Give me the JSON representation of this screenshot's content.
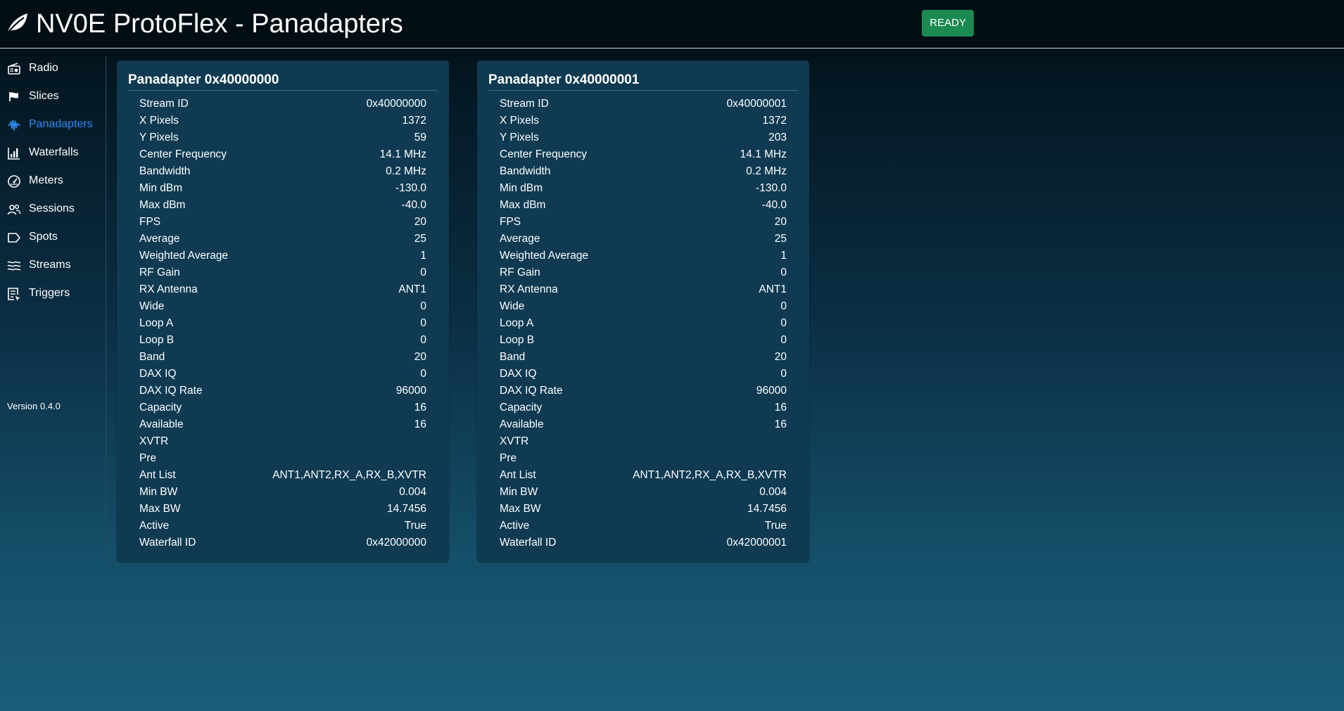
{
  "header": {
    "title": "NV0E  ProtoFlex - Panadapters",
    "logo_icon": "leaf-icon",
    "status": "READY",
    "status_color": "#1a8a51"
  },
  "sidebar": {
    "active_color": "#2d8cf0",
    "items": [
      {
        "label": "Radio",
        "icon": "radio-icon"
      },
      {
        "label": "Slices",
        "icon": "flag-icon"
      },
      {
        "label": "Panadapters",
        "icon": "waveform-icon",
        "active": true
      },
      {
        "label": "Waterfalls",
        "icon": "bar-chart-icon"
      },
      {
        "label": "Meters",
        "icon": "gauge-icon"
      },
      {
        "label": "Sessions",
        "icon": "people-icon"
      },
      {
        "label": "Spots",
        "icon": "tag-icon"
      },
      {
        "label": "Streams",
        "icon": "waves-icon"
      },
      {
        "label": "Triggers",
        "icon": "checklist-icon"
      }
    ],
    "version": "Version 0.4.0"
  },
  "panels": [
    {
      "title": "Panadapter 0x40000000",
      "rows": [
        {
          "k": "Stream ID",
          "v": "0x40000000"
        },
        {
          "k": "X Pixels",
          "v": "1372"
        },
        {
          "k": "Y Pixels",
          "v": "59"
        },
        {
          "k": "Center Frequency",
          "v": "14.1 MHz"
        },
        {
          "k": "Bandwidth",
          "v": "0.2 MHz"
        },
        {
          "k": "Min dBm",
          "v": "-130.0"
        },
        {
          "k": "Max dBm",
          "v": "-40.0"
        },
        {
          "k": "FPS",
          "v": "20"
        },
        {
          "k": "Average",
          "v": "25"
        },
        {
          "k": "Weighted Average",
          "v": "1"
        },
        {
          "k": "RF Gain",
          "v": "0"
        },
        {
          "k": "RX Antenna",
          "v": "ANT1"
        },
        {
          "k": "Wide",
          "v": "0"
        },
        {
          "k": "Loop A",
          "v": "0"
        },
        {
          "k": "Loop B",
          "v": "0"
        },
        {
          "k": "Band",
          "v": "20"
        },
        {
          "k": "DAX IQ",
          "v": "0"
        },
        {
          "k": "DAX IQ Rate",
          "v": "96000"
        },
        {
          "k": "Capacity",
          "v": "16"
        },
        {
          "k": "Available",
          "v": "16"
        },
        {
          "k": "XVTR",
          "v": ""
        },
        {
          "k": "Pre",
          "v": ""
        },
        {
          "k": "Ant List",
          "v": "ANT1,ANT2,RX_A,RX_B,XVTR"
        },
        {
          "k": "Min BW",
          "v": "0.004"
        },
        {
          "k": "Max BW",
          "v": "14.7456"
        },
        {
          "k": "Active",
          "v": "True"
        },
        {
          "k": "Waterfall ID",
          "v": "0x42000000"
        }
      ]
    },
    {
      "title": "Panadapter 0x40000001",
      "rows": [
        {
          "k": "Stream ID",
          "v": "0x40000001"
        },
        {
          "k": "X Pixels",
          "v": "1372"
        },
        {
          "k": "Y Pixels",
          "v": "203"
        },
        {
          "k": "Center Frequency",
          "v": "14.1 MHz"
        },
        {
          "k": "Bandwidth",
          "v": "0.2 MHz"
        },
        {
          "k": "Min dBm",
          "v": "-130.0"
        },
        {
          "k": "Max dBm",
          "v": "-40.0"
        },
        {
          "k": "FPS",
          "v": "20"
        },
        {
          "k": "Average",
          "v": "25"
        },
        {
          "k": "Weighted Average",
          "v": "1"
        },
        {
          "k": "RF Gain",
          "v": "0"
        },
        {
          "k": "RX Antenna",
          "v": "ANT1"
        },
        {
          "k": "Wide",
          "v": "0"
        },
        {
          "k": "Loop A",
          "v": "0"
        },
        {
          "k": "Loop B",
          "v": "0"
        },
        {
          "k": "Band",
          "v": "20"
        },
        {
          "k": "DAX IQ",
          "v": "0"
        },
        {
          "k": "DAX IQ Rate",
          "v": "96000"
        },
        {
          "k": "Capacity",
          "v": "16"
        },
        {
          "k": "Available",
          "v": "16"
        },
        {
          "k": "XVTR",
          "v": ""
        },
        {
          "k": "Pre",
          "v": ""
        },
        {
          "k": "Ant List",
          "v": "ANT1,ANT2,RX_A,RX_B,XVTR"
        },
        {
          "k": "Min BW",
          "v": "0.004"
        },
        {
          "k": "Max BW",
          "v": "14.7456"
        },
        {
          "k": "Active",
          "v": "True"
        },
        {
          "k": "Waterfall ID",
          "v": "0x42000001"
        }
      ]
    }
  ]
}
